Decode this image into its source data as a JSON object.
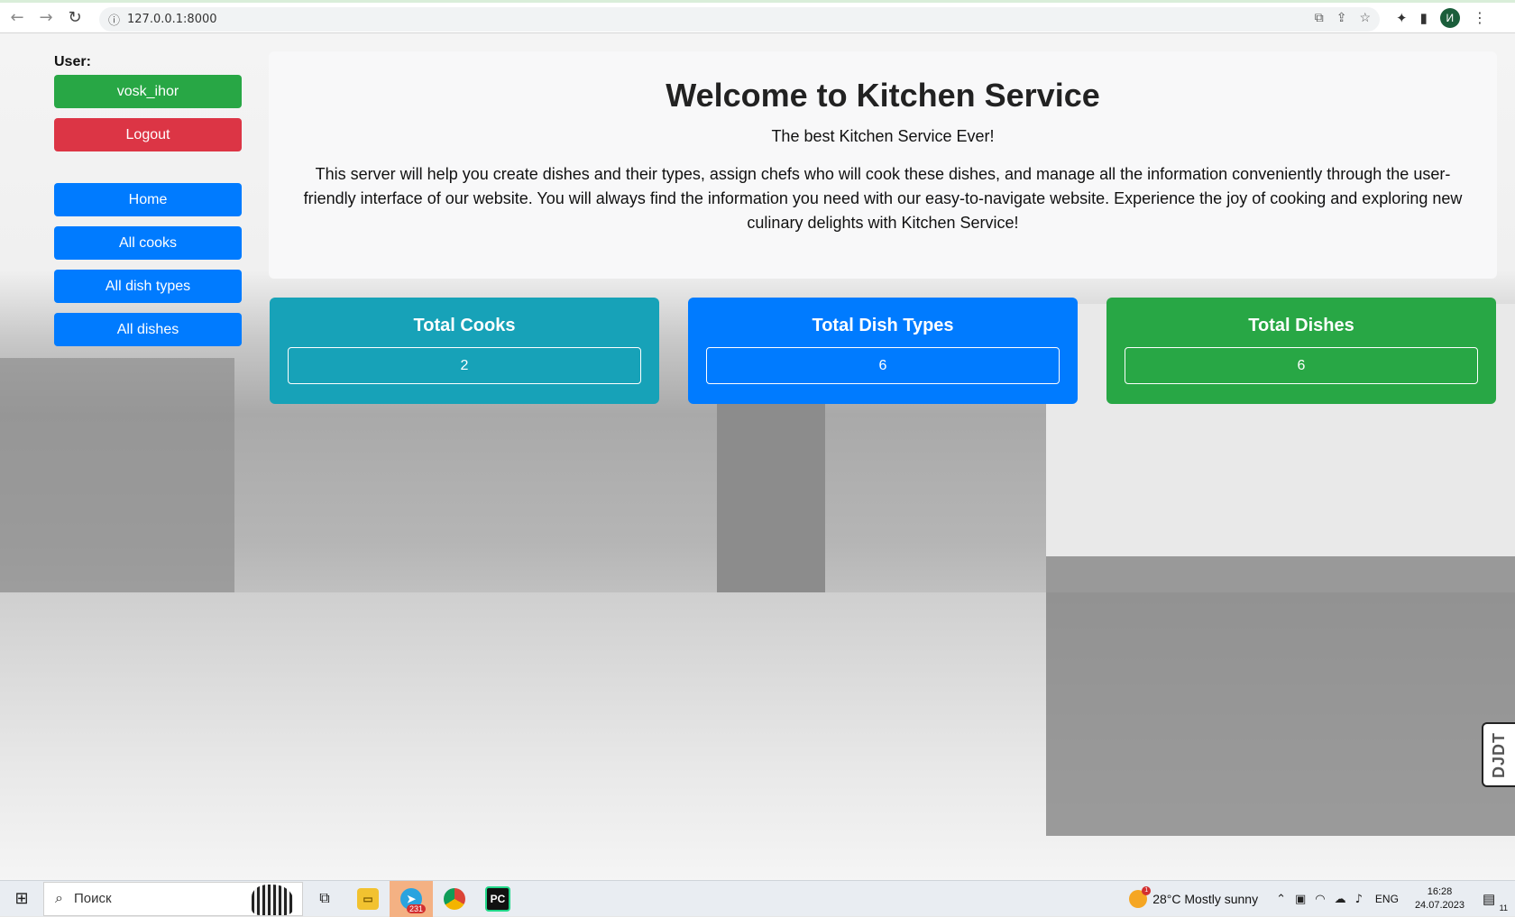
{
  "browser": {
    "url": "127.0.0.1:8000",
    "profile_initial": "И",
    "icons": [
      "back-icon",
      "forward-icon",
      "reload-icon",
      "info-icon",
      "translate-icon",
      "share-icon",
      "star-icon",
      "extensions-icon",
      "sidepanel-icon",
      "menu-icon"
    ]
  },
  "sidebar": {
    "user_label": "User:",
    "username": "vosk_ihor",
    "logout": "Logout",
    "nav": [
      {
        "label": "Home"
      },
      {
        "label": "All cooks"
      },
      {
        "label": "All dish types"
      },
      {
        "label": "All dishes"
      }
    ]
  },
  "welcome": {
    "title": "Welcome to Kitchen Service",
    "subtitle": "The best Kitchen Service Ever!",
    "description": "This server will help you create dishes and their types, assign chefs who will cook these dishes, and manage all the information conveniently through the user-friendly interface of our website. You will always find the information you need with our easy-to-navigate website. Experience the joy of cooking and exploring new culinary delights with Kitchen Service!"
  },
  "stats": [
    {
      "title": "Total Cooks",
      "value": "2",
      "color": "#17a2b8"
    },
    {
      "title": "Total Dish Types",
      "value": "6",
      "color": "#007bff"
    },
    {
      "title": "Total Dishes",
      "value": "6",
      "color": "#28a745"
    }
  ],
  "debug_toolbar": {
    "label": "DJDT"
  },
  "taskbar": {
    "search_placeholder": "Поиск",
    "telegram_badge": "231",
    "weather_alert": "1",
    "weather": "28°C  Mostly sunny",
    "lang": "ENG",
    "time": "16:28",
    "date": "24.07.2023",
    "notifications": "11"
  }
}
